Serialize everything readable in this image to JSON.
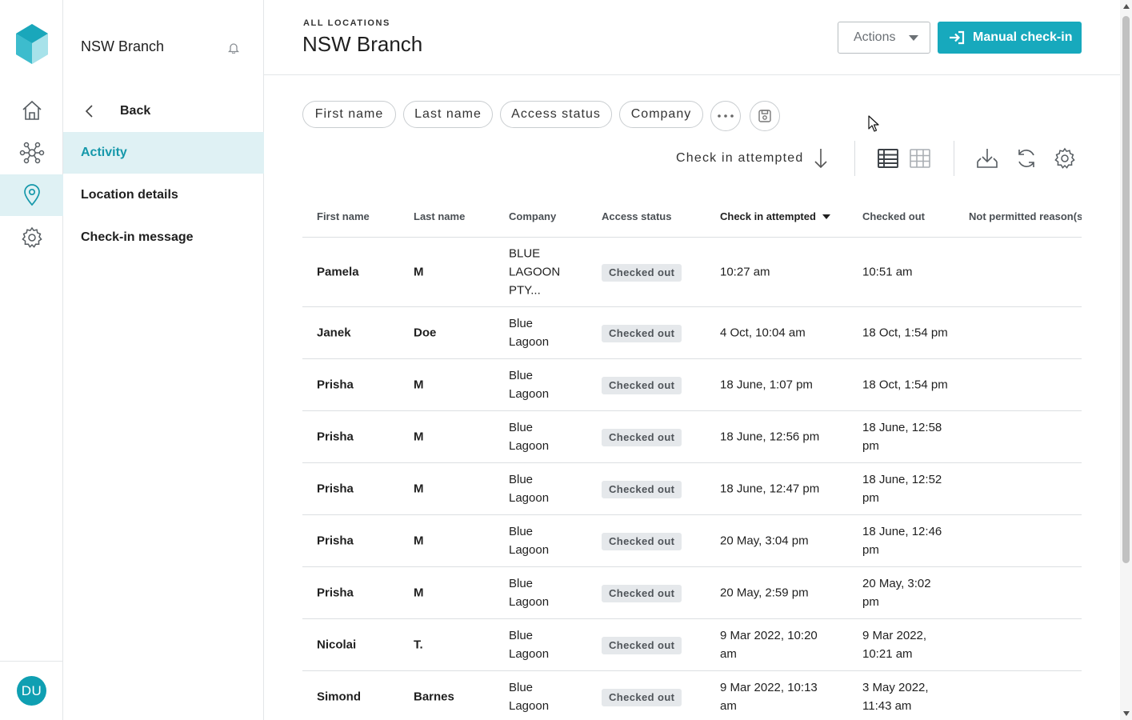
{
  "app": {
    "avatar_initials": "DU",
    "accent_color": "#17a9bd"
  },
  "rail": {
    "items": [
      {
        "icon": "home-icon"
      },
      {
        "icon": "network-icon"
      },
      {
        "icon": "location-pin-icon",
        "active": true
      },
      {
        "icon": "gear-icon"
      }
    ]
  },
  "sidebar": {
    "branch_name": "NSW Branch",
    "back_label": "Back",
    "items": [
      {
        "label": "Activity",
        "active": true
      },
      {
        "label": "Location details"
      },
      {
        "label": "Check-in message"
      }
    ]
  },
  "header": {
    "breadcrumb": "ALL LOCATIONS",
    "title": "NSW Branch",
    "actions_label": "Actions",
    "checkin_label": "Manual check-in"
  },
  "filters": {
    "chips": [
      "First name",
      "Last name",
      "Access status",
      "Company"
    ]
  },
  "toolbar": {
    "sort_label": "Check in attempted"
  },
  "table": {
    "columns": [
      "First name",
      "Last name",
      "Company",
      "Access status",
      "Check in attempted",
      "Checked out",
      "Not permitted reason(s"
    ],
    "rows": [
      {
        "first": "Pamela",
        "last": "M",
        "company": "BLUE LAGOON PTY...",
        "status": "Checked out",
        "check_in": "10:27 am",
        "checked_out": "10:51 am",
        "reason": ""
      },
      {
        "first": "Janek",
        "last": "Doe",
        "company": "Blue Lagoon",
        "status": "Checked out",
        "check_in": "4 Oct, 10:04 am",
        "checked_out": "18 Oct, 1:54 pm",
        "reason": ""
      },
      {
        "first": "Prisha",
        "last": "M",
        "company": "Blue Lagoon",
        "status": "Checked out",
        "check_in": "18 June, 1:07 pm",
        "checked_out": "18 Oct, 1:54 pm",
        "reason": ""
      },
      {
        "first": "Prisha",
        "last": "M",
        "company": "Blue Lagoon",
        "status": "Checked out",
        "check_in": "18 June, 12:56 pm",
        "checked_out": "18 June, 12:58 pm",
        "reason": ""
      },
      {
        "first": "Prisha",
        "last": "M",
        "company": "Blue Lagoon",
        "status": "Checked out",
        "check_in": "18 June, 12:47 pm",
        "checked_out": "18 June, 12:52 pm",
        "reason": ""
      },
      {
        "first": "Prisha",
        "last": "M",
        "company": "Blue Lagoon",
        "status": "Checked out",
        "check_in": "20 May, 3:04 pm",
        "checked_out": "18 June, 12:46 pm",
        "reason": ""
      },
      {
        "first": "Prisha",
        "last": "M",
        "company": "Blue Lagoon",
        "status": "Checked out",
        "check_in": "20 May, 2:59 pm",
        "checked_out": "20 May, 3:02 pm",
        "reason": ""
      },
      {
        "first": "Nicolai",
        "last": "T.",
        "company": "Blue Lagoon",
        "status": "Checked out",
        "check_in": "9 Mar 2022, 10:20 am",
        "checked_out": "9 Mar 2022, 10:21 am",
        "reason": ""
      },
      {
        "first": "Simond",
        "last": "Barnes",
        "company": "Blue Lagoon",
        "status": "Checked out",
        "check_in": "9 Mar 2022, 10:13 am",
        "checked_out": "3 May 2022, 11:43 am",
        "reason": ""
      }
    ]
  }
}
